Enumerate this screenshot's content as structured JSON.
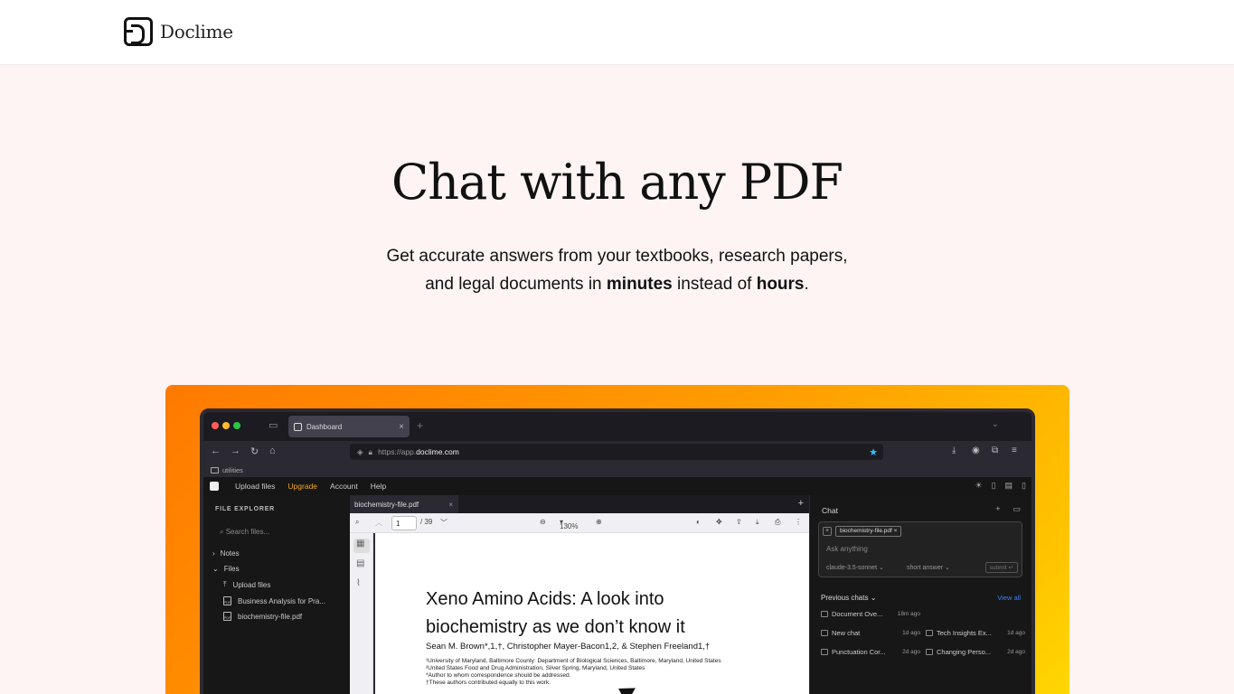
{
  "nav": {
    "brand": "Doclime"
  },
  "hero": {
    "title": "Chat with any PDF",
    "line1": "Get accurate answers from your textbooks, research papers,",
    "line2_pre": "and legal documents in ",
    "line2_b1": "minutes",
    "line2_mid": " instead of ",
    "line2_b2": "hours",
    "line2_end": "."
  },
  "browser": {
    "tab_title": "Dashboard",
    "url_scheme": "https://app.",
    "url_host": "doclime.com",
    "bookmark_folder": "utilities"
  },
  "app": {
    "menu": [
      "Upload files",
      "Upgrade",
      "Account",
      "Help"
    ]
  },
  "sidebar": {
    "title": "FILE EXPLORER",
    "search_placeholder": "Search files...",
    "notes": "Notes",
    "files": "Files",
    "upload": "Upload files",
    "file1": "Business Analysis for Pra...",
    "file2": "biochemistry-file.pdf"
  },
  "viewer": {
    "tab": "biochemistry-file.pdf",
    "page": "1",
    "total": "/ 39",
    "zoom": "130%"
  },
  "document": {
    "title_l1": "Xeno Amino Acids: A look into",
    "title_l2": "biochemistry as we don’t know it",
    "authors": "Sean M. Brown*,1,†, Christopher Mayer-Bacon1,2, & Stephen Freeland1,†",
    "aff1": "¹University of Maryland, Baltimore County: Department of Biological Sciences, Baltimore, Maryland, United States",
    "aff2": "²United States Food and Drug Administration, Silver Spring, Maryland, United States",
    "aff3": "*Author to whom correspondence should be addressed.",
    "aff4": "†These authors contributed equally to this work."
  },
  "chat": {
    "title": "Chat",
    "file_chip": "biochemistry-file.pdf ×",
    "placeholder": "Ask anything",
    "model": "claude-3.5-sonnet ⌄",
    "mode": "short answer ⌄",
    "submit": "submit ↵",
    "previous": "Previous chats ⌄",
    "view_all": "View all",
    "items": [
      {
        "label": "Document Ove...",
        "ago": "18m ago"
      },
      {
        "label": "New chat",
        "ago": "1d ago"
      },
      {
        "label": "Tech Insights Ex...",
        "ago": "1d ago"
      },
      {
        "label": "Punctuation Cor...",
        "ago": "2d ago"
      },
      {
        "label": "Changing Perso...",
        "ago": "2d ago"
      }
    ]
  }
}
